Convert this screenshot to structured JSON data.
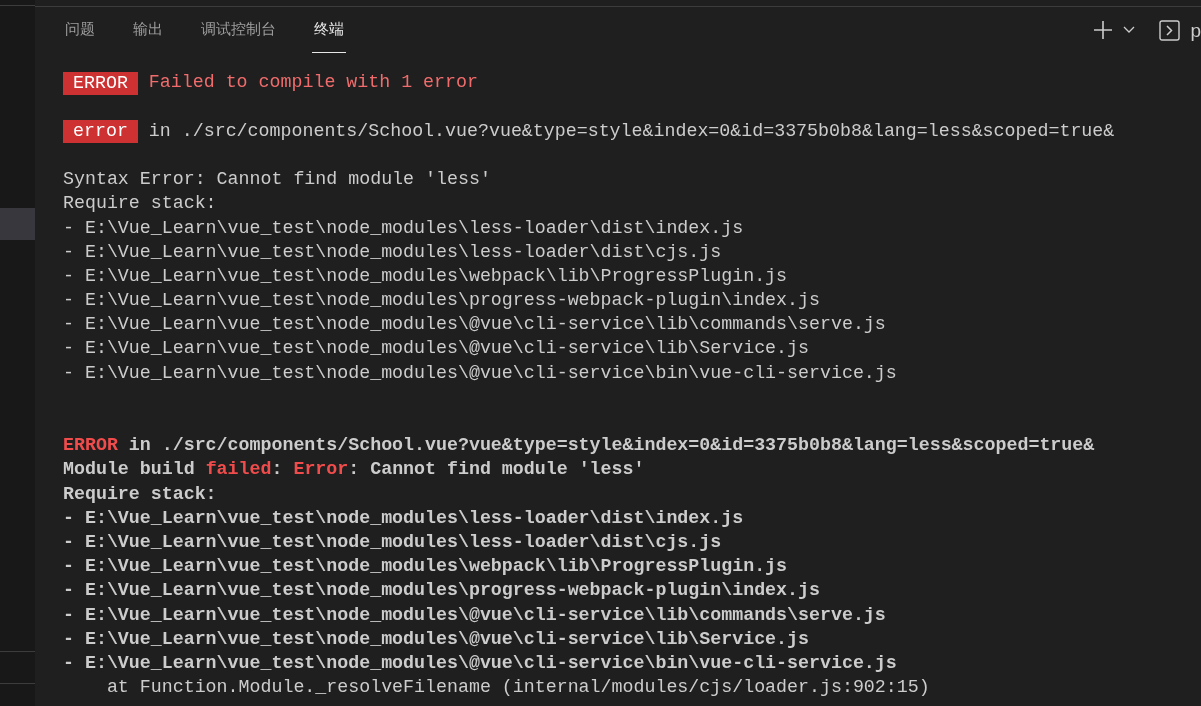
{
  "panel_tabs": [
    {
      "label": "问题",
      "selected": false
    },
    {
      "label": "输出",
      "selected": false
    },
    {
      "label": "调试控制台",
      "selected": false
    },
    {
      "label": "终端",
      "selected": true
    }
  ],
  "terminal_switcher": {
    "label": "p"
  },
  "terminal_lines": [
    {
      "bold": false,
      "segments": [
        {
          "kind": "badge",
          "text": "ERROR"
        },
        {
          "kind": "error",
          "text": "Failed to compile with 1 error"
        }
      ]
    },
    {
      "kind": "blank"
    },
    {
      "bold": false,
      "segments": [
        {
          "kind": "badge",
          "text": "error"
        },
        {
          "kind": "plain",
          "text": "in ./src/components/School.vue?vue&type=style&index=0&id=3375b0b8&lang=less&scoped=true&"
        }
      ]
    },
    {
      "kind": "blank"
    },
    {
      "bold": false,
      "segments": [
        {
          "kind": "plain",
          "text": "Syntax Error: Cannot find module 'less'"
        }
      ]
    },
    {
      "bold": false,
      "segments": [
        {
          "kind": "plain",
          "text": "Require stack:"
        }
      ]
    },
    {
      "bold": false,
      "segments": [
        {
          "kind": "plain",
          "text": "- E:\\Vue_Learn\\vue_test\\node_modules\\less-loader\\dist\\index.js"
        }
      ]
    },
    {
      "bold": false,
      "segments": [
        {
          "kind": "plain",
          "text": "- E:\\Vue_Learn\\vue_test\\node_modules\\less-loader\\dist\\cjs.js"
        }
      ]
    },
    {
      "bold": false,
      "segments": [
        {
          "kind": "plain",
          "text": "- E:\\Vue_Learn\\vue_test\\node_modules\\webpack\\lib\\ProgressPlugin.js"
        }
      ]
    },
    {
      "bold": false,
      "segments": [
        {
          "kind": "plain",
          "text": "- E:\\Vue_Learn\\vue_test\\node_modules\\progress-webpack-plugin\\index.js"
        }
      ]
    },
    {
      "bold": false,
      "segments": [
        {
          "kind": "plain",
          "text": "- E:\\Vue_Learn\\vue_test\\node_modules\\@vue\\cli-service\\lib\\commands\\serve.js"
        }
      ]
    },
    {
      "bold": false,
      "segments": [
        {
          "kind": "plain",
          "text": "- E:\\Vue_Learn\\vue_test\\node_modules\\@vue\\cli-service\\lib\\Service.js"
        }
      ]
    },
    {
      "bold": false,
      "segments": [
        {
          "kind": "plain",
          "text": "- E:\\Vue_Learn\\vue_test\\node_modules\\@vue\\cli-service\\bin\\vue-cli-service.js"
        }
      ]
    },
    {
      "kind": "blank"
    },
    {
      "kind": "blank"
    },
    {
      "bold": true,
      "segments": [
        {
          "kind": "error",
          "text": "ERROR"
        },
        {
          "kind": "plain",
          "text": " in ./src/components/School.vue?vue&type=style&index=0&id=3375b0b8&lang=less&scoped=true&"
        }
      ]
    },
    {
      "bold": true,
      "segments": [
        {
          "kind": "plain",
          "text": "Module build "
        },
        {
          "kind": "error",
          "text": "failed"
        },
        {
          "kind": "plain",
          "text": ": "
        },
        {
          "kind": "error",
          "text": "Error"
        },
        {
          "kind": "plain",
          "text": ": Cannot find module 'less'"
        }
      ]
    },
    {
      "bold": true,
      "segments": [
        {
          "kind": "plain",
          "text": "Require stack:"
        }
      ]
    },
    {
      "bold": true,
      "segments": [
        {
          "kind": "plain",
          "text": "- E:\\Vue_Learn\\vue_test\\node_modules\\less-loader\\dist\\index.js"
        }
      ]
    },
    {
      "bold": true,
      "segments": [
        {
          "kind": "plain",
          "text": "- E:\\Vue_Learn\\vue_test\\node_modules\\less-loader\\dist\\cjs.js"
        }
      ]
    },
    {
      "bold": true,
      "segments": [
        {
          "kind": "plain",
          "text": "- E:\\Vue_Learn\\vue_test\\node_modules\\webpack\\lib\\ProgressPlugin.js"
        }
      ]
    },
    {
      "bold": true,
      "segments": [
        {
          "kind": "plain",
          "text": "- E:\\Vue_Learn\\vue_test\\node_modules\\progress-webpack-plugin\\index.js"
        }
      ]
    },
    {
      "bold": true,
      "segments": [
        {
          "kind": "plain",
          "text": "- E:\\Vue_Learn\\vue_test\\node_modules\\@vue\\cli-service\\lib\\commands\\serve.js"
        }
      ]
    },
    {
      "bold": true,
      "segments": [
        {
          "kind": "plain",
          "text": "- E:\\Vue_Learn\\vue_test\\node_modules\\@vue\\cli-service\\lib\\Service.js"
        }
      ]
    },
    {
      "bold": true,
      "segments": [
        {
          "kind": "plain",
          "text": "- E:\\Vue_Learn\\vue_test\\node_modules\\@vue\\cli-service\\bin\\vue-cli-service.js"
        }
      ]
    },
    {
      "bold": false,
      "segments": [
        {
          "kind": "plain",
          "text": "    at Function.Module._resolveFilename (internal/modules/cjs/loader.js:902:15)"
        }
      ]
    }
  ]
}
